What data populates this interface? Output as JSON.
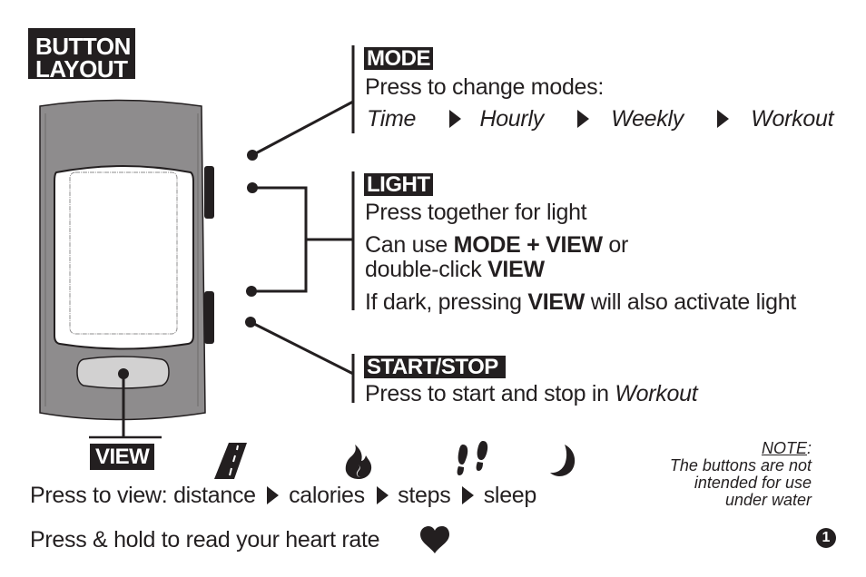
{
  "title": {
    "line1": "BUTTON",
    "line2": "LAYOUT"
  },
  "mode": {
    "tag": "MODE",
    "description": "Press to change modes:",
    "sequence": [
      "Time",
      "Hourly",
      "Weekly",
      "Workout"
    ]
  },
  "light": {
    "tag": "LIGHT",
    "line1": "Press together for light",
    "line2_prefix": "Can use ",
    "line2_bold": "MODE + VIEW",
    "line2_suffix": " or",
    "line3_prefix": "double-click ",
    "line3_bold": "VIEW",
    "line4_prefix": "If dark, pressing ",
    "line4_bold": "VIEW",
    "line4_suffix": " will also activate light"
  },
  "startstop": {
    "tag": "START/STOP",
    "description_prefix": "Press to start and stop in ",
    "description_italic": "Workout"
  },
  "view": {
    "tag": "VIEW",
    "description_prefix": "Press to view: ",
    "sequence": [
      "distance",
      "calories",
      "steps",
      "sleep"
    ],
    "icons": [
      "road-icon",
      "flame-icon",
      "footprints-icon",
      "moon-icon"
    ],
    "hold_text": "Press & hold to read your heart rate"
  },
  "note": {
    "label": "NOTE",
    "colon": ":",
    "lines": [
      "The buttons are not",
      "intended for use",
      "under water"
    ]
  },
  "page_number": "1",
  "colors": {
    "ink": "#231f20",
    "device_body": "#8e8c8d",
    "screen": "#ffffff",
    "view_button": "#d2d1d1"
  }
}
